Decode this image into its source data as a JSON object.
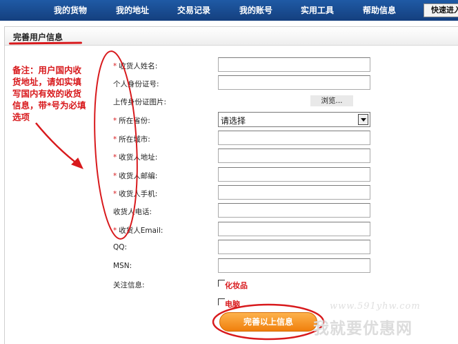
{
  "nav": {
    "items": [
      "我的货物",
      "我的地址",
      "交易记录",
      "我的账号",
      "实用工具",
      "帮助信息"
    ],
    "quick_button": "快速进入"
  },
  "panel": {
    "title": "完善用户信息"
  },
  "note": "备注：用户国内收货地址，请如实填写国内有效的收货信息，带*号为必填选项",
  "form": {
    "required_mark": "*",
    "name_label": "收货人姓名:",
    "id_label": "个人身份证号:",
    "id_photo_label": "上传身份证图片:",
    "browse_label": "浏览...",
    "province_label": "所在省份:",
    "province_value": "请选择",
    "city_label": "所在城市:",
    "address_label": "收货人地址:",
    "postcode_label": "收货人邮编:",
    "mobile_label": "收货人手机:",
    "phone_label": "收货人电话:",
    "email_label": "收货人Email:",
    "qq_label": "QQ:",
    "msn_label": "MSN:",
    "interest_label": "关注信息:",
    "interest_options": [
      "化妆品",
      "电脑"
    ],
    "submit_label": "完善以上信息"
  },
  "watermark": {
    "url": "www.591yhw.com",
    "logo": "我就要优惠网"
  },
  "colors": {
    "nav_bg": "#1a4f96",
    "annotation_red": "#d8191c",
    "button_orange": "#f39320"
  }
}
